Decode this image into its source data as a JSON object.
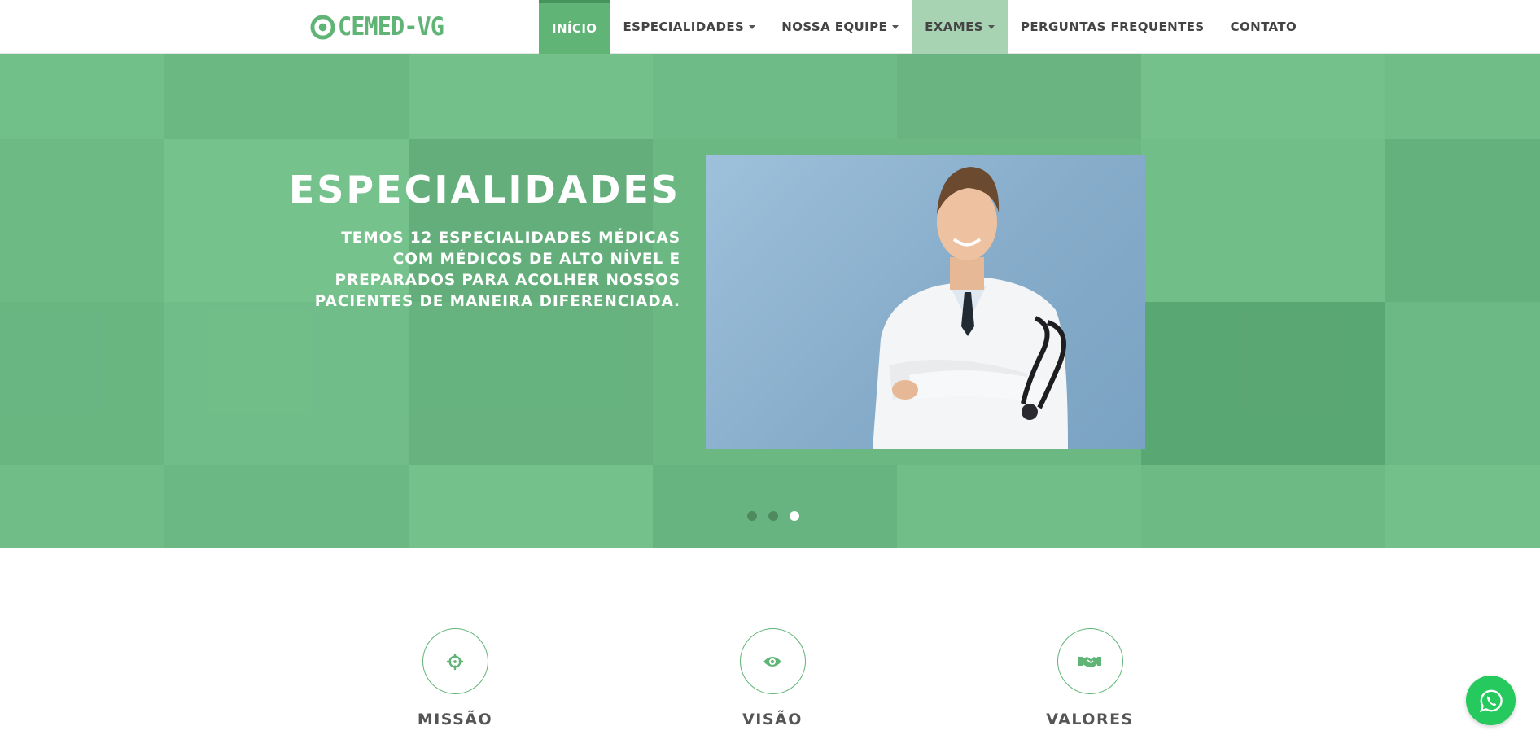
{
  "brand": {
    "name": "CEMED-VG",
    "icon": "target-circle-icon"
  },
  "nav": {
    "items": [
      {
        "label": "INÍCIO",
        "dropdown": false,
        "state": "active"
      },
      {
        "label": "ESPECIALIDADES",
        "dropdown": true,
        "state": "normal"
      },
      {
        "label": "NOSSA EQUIPE",
        "dropdown": true,
        "state": "normal"
      },
      {
        "label": "EXAMES",
        "dropdown": true,
        "state": "hover"
      },
      {
        "label": "PERGUNTAS FREQUENTES",
        "dropdown": false,
        "state": "normal"
      },
      {
        "label": "CONTATO",
        "dropdown": false,
        "state": "normal"
      }
    ]
  },
  "hero": {
    "title": "ESPECIALIDADES",
    "text": "TEMOS 12 ESPECIALIDADES MÉDICAS COM MÉDICOS DE ALTO NÍVEL E PREPARADOS PARA ACOLHER NOSSOS PACIENTES DE MANEIRA DIFERENCIADA.",
    "image": "doctor-with-stethoscope-photo",
    "slides": {
      "count": 3,
      "active": 3
    }
  },
  "features": [
    {
      "title": "MISSÃO",
      "icon": "crosshair-icon"
    },
    {
      "title": "VISÃO",
      "icon": "eye-icon"
    },
    {
      "title": "VALORES",
      "icon": "handshake-icon"
    }
  ],
  "whatsapp": {
    "icon": "whatsapp-icon"
  },
  "colors": {
    "brand_green": "#5fb476",
    "active_nav": "#5fb476",
    "hover_nav": "#a8d3b3",
    "hero_tint": "#6fbd86",
    "whatsapp": "#25c95d"
  }
}
